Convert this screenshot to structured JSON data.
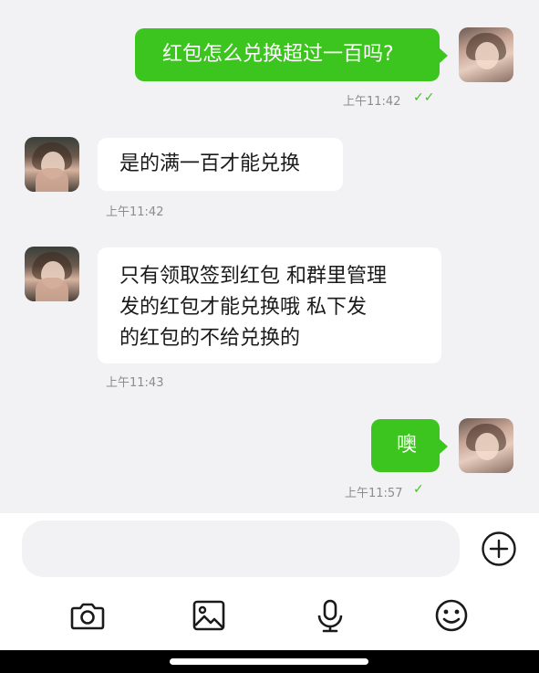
{
  "messages": [
    {
      "direction": "outgoing",
      "text": "红包怎么兑换超过一百吗?",
      "time": "上午11:42",
      "read_receipt": "double-check-icon"
    },
    {
      "direction": "incoming",
      "text": "是的满一百才能兑换",
      "time": "上午11:42"
    },
    {
      "direction": "incoming",
      "lines": [
        "只有领取签到红包 和群里管理",
        "发的红包才能兑换哦 私下发",
        "的红包的不给兑换的"
      ],
      "time": "上午11:43"
    },
    {
      "direction": "outgoing",
      "text": "噢",
      "time": "上午11:57",
      "read_receipt": "single-check-icon"
    }
  ],
  "composer": {
    "input_value": "",
    "icons": [
      "plus-icon",
      "camera-icon",
      "image-icon",
      "microphone-icon",
      "emoji-icon"
    ]
  },
  "colors": {
    "outgoing_bubble": "#3cc51f",
    "incoming_bubble": "#ffffff",
    "chat_background": "#f2f2f5",
    "timestamp": "#8c8c8c"
  }
}
